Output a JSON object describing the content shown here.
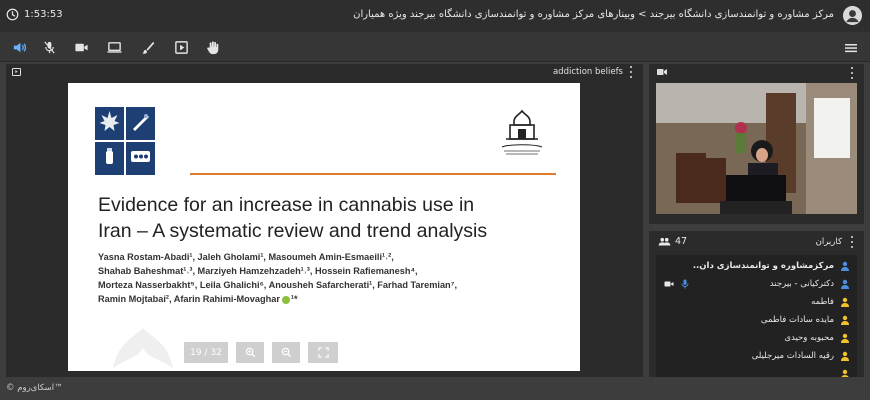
{
  "window": {
    "elapsed_time": "1:53:53",
    "title": "مرکز مشاوره و توانمندسازی دانشگاه بیرجند > وبینارهای مرکز مشاوره و توانمندسازی دانشگاه بیرجند ویژه همیاران"
  },
  "toolbar": {
    "tools": [
      "speaker-icon",
      "mic-off-icon",
      "camera-icon",
      "screen-share-icon",
      "brush-icon",
      "play-media-icon",
      "raise-hand-icon"
    ],
    "menu_icon": "hamburger-icon"
  },
  "presentation": {
    "title": "addiction beliefs",
    "slide": {
      "heading_line1": "Evidence for an increase in cannabis use in",
      "heading_line2": "Iran – A systematic review and trend analysis",
      "authors_line1": "Yasna Rostam-Abadi¹, Jaleh Gholami¹, Masoumeh Amin-Esmaeili¹˒²,",
      "authors_line2": "Shahab Baheshmat¹˒³, Marziyeh Hamzehzadeh¹˒³, Hossein Rafiemanesh⁴,",
      "authors_line3": "Morteza Nasserbakht⁵, Leila Ghalichi⁶, Anousheh Safarcherati¹, Farhad Taremian⁷,",
      "authors_line4": "Ramin Mojtabai², Afarin Rahimi-Movaghar",
      "authors_tail": "¹*",
      "rule_color": "#e07a2f",
      "logo_color": "#1d3f74"
    },
    "controls": {
      "page_indicator": "19 / 32"
    }
  },
  "footer": {
    "copyright": "© اسکای‌روم™"
  },
  "users": {
    "count": "47",
    "title": "کاربران",
    "list": [
      {
        "name": "مرکزمشاوره و توانمندسازی دان..",
        "role": "host"
      },
      {
        "name": "دکترکیانی - بیرجند",
        "role": "presenter"
      },
      {
        "name": "فاطمه",
        "role": "guest"
      },
      {
        "name": "مایده سادات فاطمی",
        "role": "guest"
      },
      {
        "name": "محبوبه وحیدی",
        "role": "guest"
      },
      {
        "name": "رقیه السادات میرجلیلی",
        "role": "guest"
      }
    ]
  }
}
